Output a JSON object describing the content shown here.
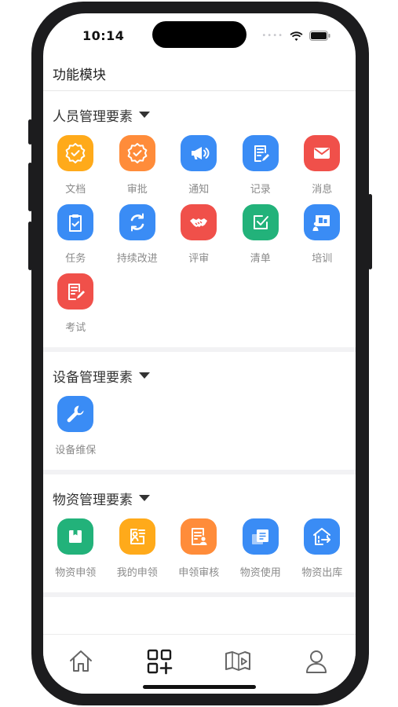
{
  "status_bar": {
    "time": "10:14"
  },
  "header": {
    "title": "功能模块"
  },
  "sections": [
    {
      "title": "人员管理要素",
      "items": [
        {
          "label": "文档",
          "icon": "badge-check-icon",
          "color": "#FFAA1A"
        },
        {
          "label": "审批",
          "icon": "badge-check-icon",
          "color": "#FF8C3A"
        },
        {
          "label": "通知",
          "icon": "megaphone-icon",
          "color": "#3A8CF5"
        },
        {
          "label": "记录",
          "icon": "document-edit-icon",
          "color": "#3A8CF5"
        },
        {
          "label": "消息",
          "icon": "envelope-icon",
          "color": "#F0504A"
        },
        {
          "label": "任务",
          "icon": "clipboard-check-icon",
          "color": "#3A8CF5"
        },
        {
          "label": "持续改进",
          "icon": "cycle-icon",
          "color": "#3A8CF5"
        },
        {
          "label": "评审",
          "icon": "handshake-icon",
          "color": "#F0504A"
        },
        {
          "label": "清单",
          "icon": "checkbox-icon",
          "color": "#22B27A"
        },
        {
          "label": "培训",
          "icon": "presentation-icon",
          "color": "#3A8CF5"
        },
        {
          "label": "考试",
          "icon": "exam-edit-icon",
          "color": "#F0504A"
        }
      ]
    },
    {
      "title": "设备管理要素",
      "items": [
        {
          "label": "设备维保",
          "icon": "wrench-icon",
          "color": "#3A8CF5"
        }
      ]
    },
    {
      "title": "物资管理要素",
      "items": [
        {
          "label": "物资申领",
          "icon": "box-icon",
          "color": "#22B27A"
        },
        {
          "label": "我的申领",
          "icon": "contact-card-icon",
          "color": "#FFAA1A"
        },
        {
          "label": "申领审核",
          "icon": "review-list-icon",
          "color": "#FF8C3A"
        },
        {
          "label": "物资使用",
          "icon": "pages-icon",
          "color": "#3A8CF5"
        },
        {
          "label": "物资出库",
          "icon": "warehouse-out-icon",
          "color": "#3A8CF5"
        }
      ]
    }
  ],
  "tabbar": {
    "tabs": [
      {
        "icon": "home-icon",
        "active": false
      },
      {
        "icon": "apps-add-icon",
        "active": true
      },
      {
        "icon": "book-video-icon",
        "active": false
      },
      {
        "icon": "user-icon",
        "active": false
      }
    ]
  }
}
